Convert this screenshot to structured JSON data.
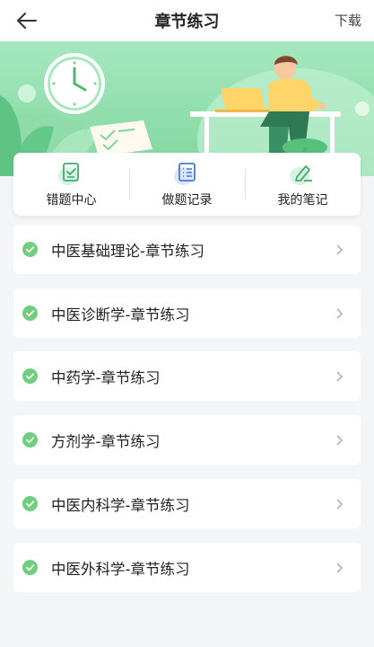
{
  "header": {
    "title": "章节练习",
    "download_label": "下载"
  },
  "shortcuts": [
    {
      "label": "错题中心",
      "icon": "mistake-book-icon"
    },
    {
      "label": "做题记录",
      "icon": "record-list-icon"
    },
    {
      "label": "我的笔记",
      "icon": "pen-note-icon"
    }
  ],
  "chapters": [
    {
      "label": "中医基础理论-章节练习"
    },
    {
      "label": "中医诊断学-章节练习"
    },
    {
      "label": "中药学-章节练习"
    },
    {
      "label": "方剂学-章节练习"
    },
    {
      "label": "中医内科学-章节练习"
    },
    {
      "label": "中医外科学-章节练习"
    }
  ],
  "colors": {
    "accent_green": "#6fcf7f",
    "banner_green": "#9ee3b6",
    "page_bg": "#f4f5f7"
  }
}
